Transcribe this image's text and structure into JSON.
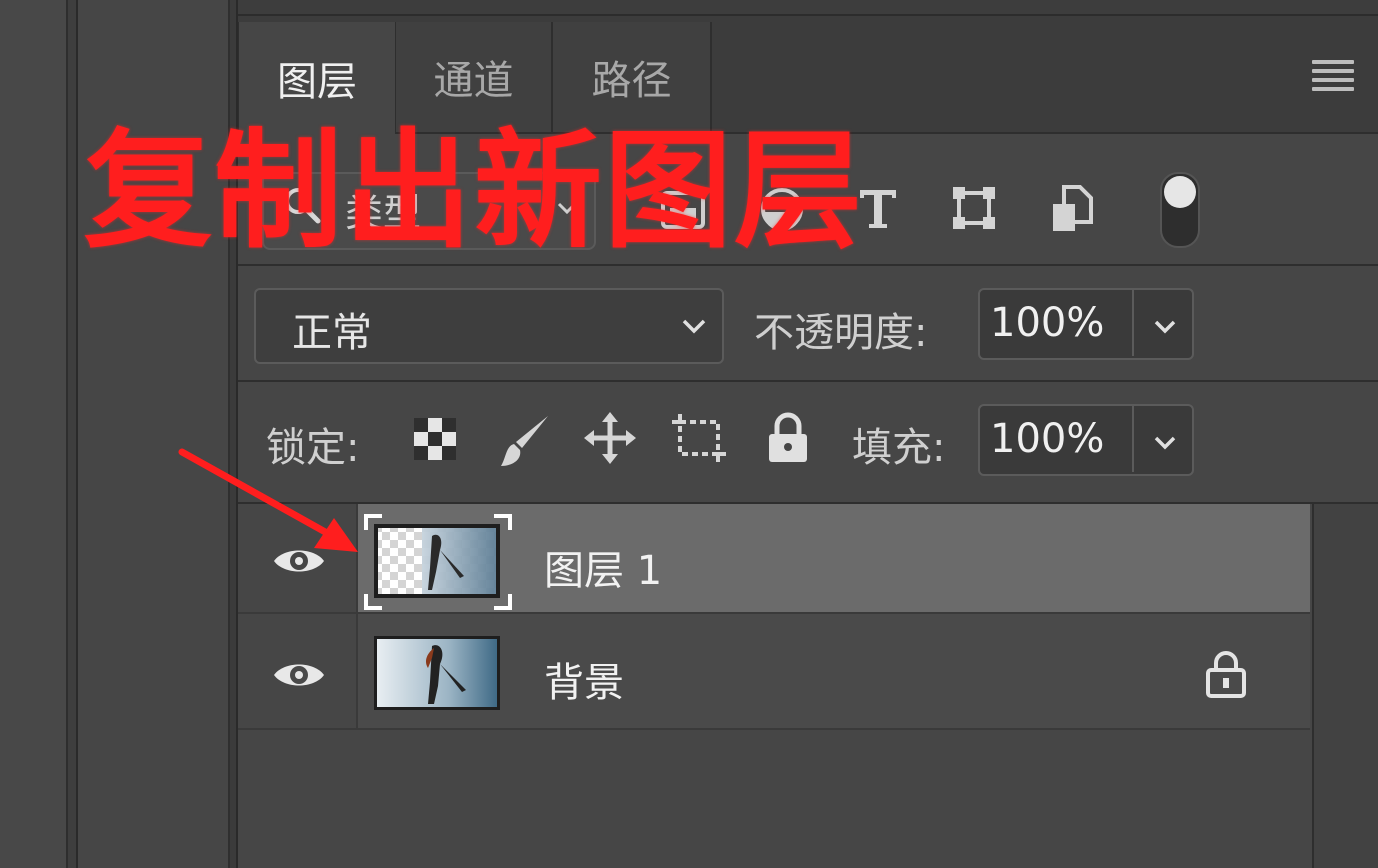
{
  "tabs": [
    {
      "label": "图层",
      "active": true
    },
    {
      "label": "通道",
      "active": false
    },
    {
      "label": "路径",
      "active": false
    }
  ],
  "filter": {
    "kind_label": "类型"
  },
  "blend": {
    "mode": "正常"
  },
  "opacity": {
    "label": "不透明度:",
    "value": "100%"
  },
  "lock": {
    "label": "锁定:"
  },
  "fill": {
    "label": "填充:",
    "value": "100%"
  },
  "layers": [
    {
      "name": "图层 1",
      "selected": true,
      "visible": true,
      "locked": false
    },
    {
      "name": "背景",
      "selected": false,
      "visible": true,
      "locked": true
    }
  ],
  "annotation": {
    "text": "复制出新图层",
    "color": "#ff1e1e"
  },
  "colors": {
    "panel": "#464646",
    "selected_layer": "#6b6b6b",
    "accent_red": "#ff1e1e"
  }
}
